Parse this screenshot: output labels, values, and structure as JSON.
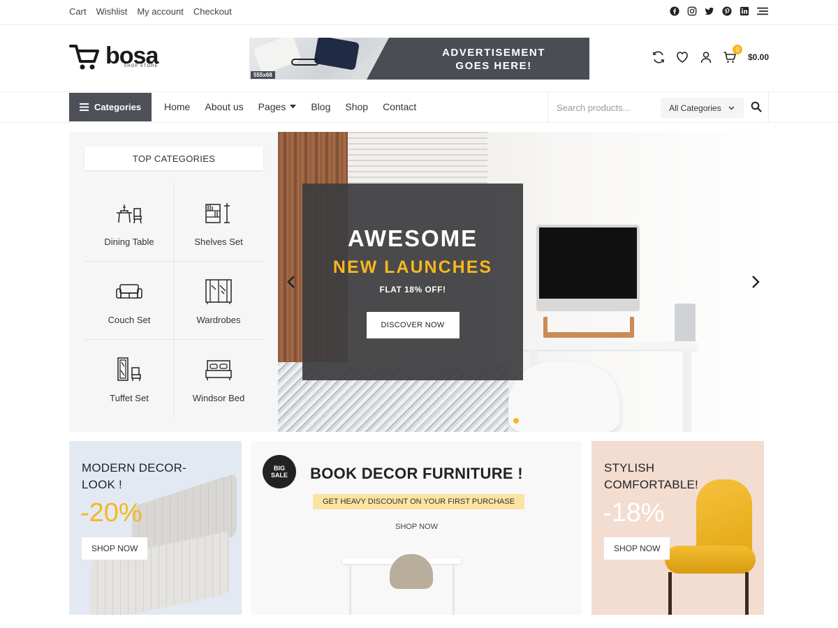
{
  "topbar": {
    "links": [
      "Cart",
      "Wishlist",
      "My account",
      "Checkout"
    ],
    "social_icons": [
      "facebook-icon",
      "instagram-icon",
      "twitter-icon",
      "pinterest-icon",
      "linkedin-icon",
      "menu-icon"
    ]
  },
  "header": {
    "logo_name": "bosa",
    "logo_tagline": "SHOP STORE",
    "ad_size": "555x68",
    "ad_line1": "ADVERTISEMENT",
    "ad_line2": "GOES HERE!",
    "cart_count": "0",
    "cart_total": "$0.00"
  },
  "nav": {
    "categories_label": "Categories",
    "menu": [
      "Home",
      "About us",
      "Pages",
      "Blog",
      "Shop",
      "Contact"
    ],
    "search_placeholder": "Search products...",
    "search_category": "All Categories"
  },
  "top_categories": {
    "title": "TOP CATEGORIES",
    "items": [
      "Dining Table",
      "Shelves Set",
      "Couch Set",
      "Wardrobes",
      "Tuffet Set",
      "Windsor Bed"
    ]
  },
  "hero": {
    "title1": "AWESOME",
    "title2": "NEW LAUNCHES",
    "subtitle": "FLAT 18% OFF!",
    "button": "DISCOVER NOW"
  },
  "promos": {
    "left": {
      "title1": "MODERN DECOR-",
      "title2": "LOOK !",
      "discount": "-20%",
      "button": "SHOP NOW"
    },
    "center": {
      "badge1": "BIG",
      "badge2": "SALE",
      "title": "BOOK DECOR FURNITURE !",
      "subtitle": "GET HEAVY DISCOUNT ON YOUR FIRST PURCHASE",
      "link": "SHOP NOW"
    },
    "right": {
      "title1": "STYLISH",
      "title2": "COMFORTABLE!",
      "discount": "-18%",
      "button": "SHOP NOW"
    }
  },
  "colors": {
    "accent": "#f6b720",
    "dark": "#4e5058"
  }
}
